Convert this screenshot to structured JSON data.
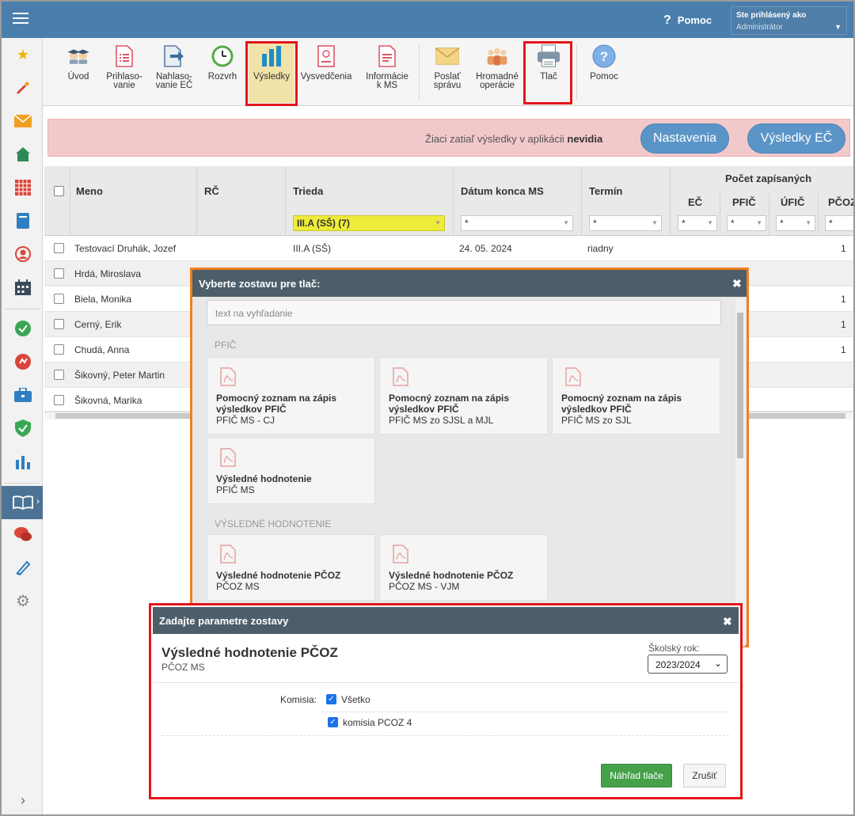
{
  "topbar": {
    "help_label": "Pomoc",
    "user_label": "Ste prihlásený ako",
    "user_role": "Administrátor"
  },
  "toolbar": {
    "items": [
      {
        "label1": "Úvod",
        "label2": "",
        "icon": "students-icon"
      },
      {
        "label1": "Prihlaso-",
        "label2": "vanie",
        "icon": "form-icon"
      },
      {
        "label1": "Nahlaso-",
        "label2": "vanie EČ",
        "icon": "report-arrow-icon"
      },
      {
        "label1": "Rozvrh",
        "label2": "",
        "icon": "clock-icon"
      },
      {
        "label1": "Výsledky",
        "label2": "",
        "icon": "bar-chart-icon"
      },
      {
        "label1": "Vysvedčenia",
        "label2": "",
        "icon": "certificate-icon"
      },
      {
        "label1": "Informácie",
        "label2": "k MS",
        "icon": "document-icon"
      },
      {
        "label1": "Poslať",
        "label2": "správu",
        "icon": "envelope-icon"
      },
      {
        "label1": "Hromadné",
        "label2": "operácie",
        "icon": "group-icon"
      },
      {
        "label1": "Tlač",
        "label2": "",
        "icon": "printer-icon"
      },
      {
        "label1": "Pomoc",
        "label2": "",
        "icon": "help-icon"
      }
    ]
  },
  "banner": {
    "text_prefix": "Žiaci zatiaľ výsledky v aplikácii",
    "text_bold": "nevidia",
    "settings_button": "Nastavenia",
    "results_button": "Výsledky EČ"
  },
  "table": {
    "columns": {
      "name": "Meno",
      "rc": "RČ",
      "class": "Trieda",
      "date": "Dátum konca MS",
      "term": "Termín",
      "group": "Počet zapísaných",
      "ec": "EČ",
      "pfic": "PFIČ",
      "ufic": "ÚFIČ",
      "pcoz": "PČOZ"
    },
    "filters": {
      "class": "III.A (SŠ) (7)",
      "date": "*",
      "term": "*",
      "ec": "*",
      "pfic": "*",
      "ufic": "*",
      "pcoz": "*"
    },
    "rows": [
      {
        "name": "Testovací Druhák, Jozef",
        "class": "III.A (SŠ)",
        "date": "24. 05. 2024",
        "term": "riadny",
        "pcoz": "1"
      },
      {
        "name": "Hrdá, Miroslava",
        "class": "",
        "date": "",
        "term": "",
        "pcoz": ""
      },
      {
        "name": "Biela, Monika",
        "class": "",
        "date": "",
        "term": "",
        "pcoz": "1"
      },
      {
        "name": "Cerný, Erik",
        "class": "",
        "date": "",
        "term": "",
        "pcoz": "1"
      },
      {
        "name": "Chudá, Anna",
        "class": "",
        "date": "",
        "term": "",
        "pcoz": "1"
      },
      {
        "name": "Šikovný, Peter Martin",
        "class": "",
        "date": "",
        "term": "",
        "pcoz": ""
      },
      {
        "name": "Šikovná, Marika",
        "class": "",
        "date": "",
        "term": "",
        "pcoz": ""
      }
    ]
  },
  "report_dialog": {
    "title": "Vyberte zostavu pre tlač:",
    "search_placeholder": "text na vyhľadanie",
    "section1": "PFIČ",
    "section2": "VÝSLEDNÉ HODNOTENIE",
    "cards1": [
      {
        "title1": "Pomocný zoznam na zápis",
        "title2": "výsledkov PFIČ",
        "sub": "PFIČ MS - CJ"
      },
      {
        "title1": "Pomocný zoznam na zápis",
        "title2": "výsledkov PFIČ",
        "sub": "PFIČ MS zo SJSL a MJL"
      },
      {
        "title1": "Pomocný zoznam na zápis",
        "title2": "výsledkov PFIČ",
        "sub": "PFIČ MS zo SJL"
      },
      {
        "title1": "Výsledné hodnotenie",
        "title2": "",
        "sub": "PFIČ MS"
      }
    ],
    "cards2": [
      {
        "title1": "Výsledné hodnotenie PČOZ",
        "title2": "",
        "sub": "PČOZ MS"
      },
      {
        "title1": "Výsledné hodnotenie PČOZ",
        "title2": "",
        "sub": "PČOZ MS - VJM"
      }
    ]
  },
  "params_dialog": {
    "title": "Zadajte parametre zostavy",
    "heading": "Výsledné hodnotenie PČOZ",
    "subheading": "PČOZ MS",
    "year_label": "Školský rok:",
    "year_value": "2023/2024",
    "komisia_label": "Komisia:",
    "opt_all": "Všetko",
    "opt_k4": "komisia PCOZ 4",
    "preview_button": "Náhľad tlače",
    "cancel_button": "Zrušiť"
  },
  "colors": {
    "topbar": "#4a7fad",
    "highlight_red": "#e3151b",
    "highlight_orange": "#f07f1e",
    "primary_pill": "#5b95c8",
    "success_green": "#46a14a",
    "banner_pink": "#f2c9cb",
    "filter_yellow": "#eeeb3a"
  }
}
